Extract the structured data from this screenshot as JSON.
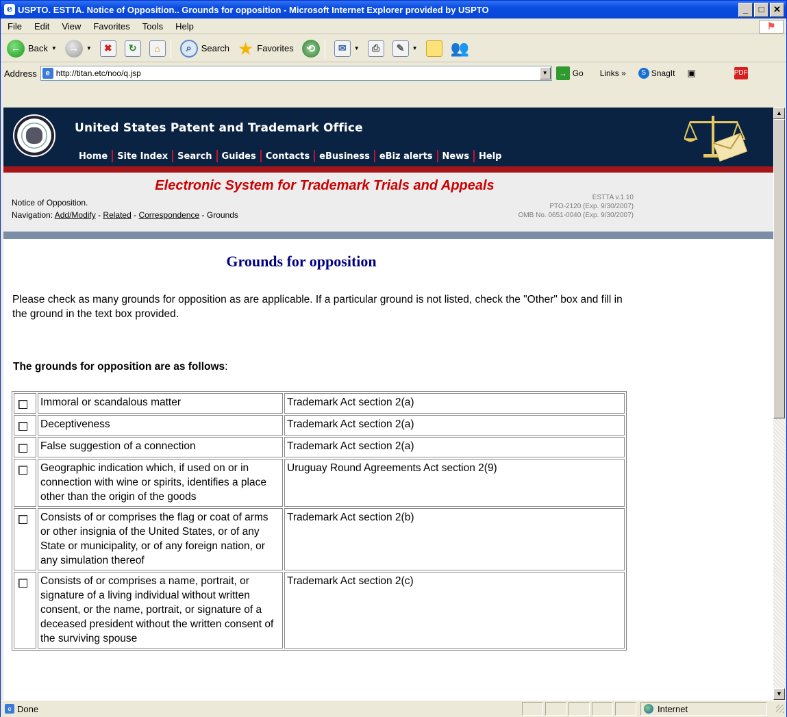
{
  "window": {
    "title": "USPTO. ESTTA. Notice of Opposition.. Grounds for opposition - Microsoft Internet Explorer provided by USPTO",
    "controls": [
      "_",
      "□",
      "✕"
    ]
  },
  "menubar": {
    "items": [
      "File",
      "Edit",
      "View",
      "Favorites",
      "Tools",
      "Help"
    ]
  },
  "toolbar": {
    "back_label": "Back",
    "search_label": "Search",
    "favorites_label": "Favorites"
  },
  "address": {
    "label": "Address",
    "url": "http://titan.etc/noo/q.jsp",
    "go_label": "Go",
    "links_label": "Links",
    "snagit_label": "SnagIt"
  },
  "page": {
    "office_title": "United States Patent and Trademark Office",
    "nav": [
      "Home",
      "Site Index",
      "Search",
      "Guides",
      "Contacts",
      "eBusiness",
      "eBiz alerts",
      "News",
      "Help"
    ],
    "system_title": "Electronic System for Trademark Trials and Appeals",
    "notice_label": "Notice of Opposition.",
    "navigation_prefix": "Navigation:",
    "nav_links": [
      "Add/Modify",
      "Related",
      "Correspondence"
    ],
    "nav_current": "Grounds",
    "separator": " - ",
    "version": "ESTTA v.1.10",
    "form_no": "PTO-2120 (Exp. 9/30/2007)",
    "omb_no": "OMB No. 0651-0040 (Exp. 9/30/2007)",
    "heading": "Grounds for opposition",
    "intro": "Please check as many grounds for opposition as are applicable. If a particular ground is not listed, check the \"Other\" box and fill in the ground in the text box provided.",
    "grounds_label": "The grounds for opposition are as follows",
    "grounds_colon": ":"
  },
  "grounds": [
    {
      "ground": "Immoral or scandalous matter",
      "section": "Trademark Act section 2(a)",
      "checked": false
    },
    {
      "ground": "Deceptiveness",
      "section": "Trademark Act section 2(a)",
      "checked": false
    },
    {
      "ground": "False suggestion of a connection",
      "section": "Trademark Act section 2(a)",
      "checked": false
    },
    {
      "ground": "Geographic indication which, if used on or in connection with wine or spirits, identifies a place other than the origin of the goods",
      "section": "Uruguay Round Agreements Act section 2(9)",
      "checked": false
    },
    {
      "ground": "Consists of or comprises the flag or coat of arms or other insignia of the United States, or of any State or municipality, or of any foreign nation, or any simulation thereof",
      "section": "Trademark Act section 2(b)",
      "checked": false
    },
    {
      "ground": "Consists of or comprises a name, portrait, or signature of a living individual without written consent, or the name, portrait, or signature of a deceased president without the written consent of the surviving spouse",
      "section": "Trademark Act section 2(c)",
      "checked": false
    }
  ],
  "status": {
    "text": "Done",
    "zone": "Internet"
  }
}
